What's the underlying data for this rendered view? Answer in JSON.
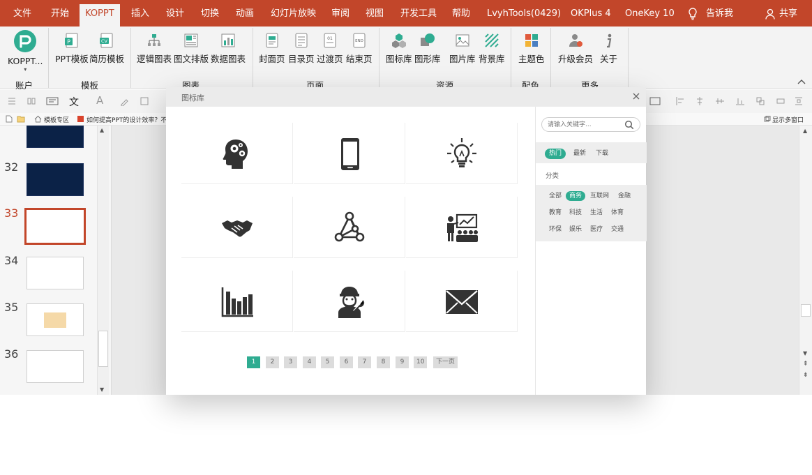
{
  "menu": {
    "items": [
      "文件",
      "开始",
      "KOPPT",
      "插入",
      "设计",
      "切换",
      "动画",
      "幻灯片放映",
      "审阅",
      "视图",
      "开发工具",
      "帮助",
      "LvyhTools(0429)",
      "OKPlus 4",
      "OneKey 10"
    ],
    "tell_me": "告诉我",
    "share": "共享"
  },
  "ribbon": {
    "account": {
      "button": "KOPPT...",
      "group": "账户"
    },
    "template": {
      "buttons": [
        "PPT模板",
        "简历模板"
      ],
      "group": "模板"
    },
    "chart": {
      "buttons": [
        "逻辑图表",
        "图文排版",
        "数据图表"
      ],
      "group": "图表"
    },
    "page": {
      "buttons": [
        "封面页",
        "目录页",
        "过渡页",
        "结束页"
      ],
      "group": "页面"
    },
    "resource": {
      "buttons": [
        "图标库",
        "图形库",
        "图片库",
        "背景库"
      ],
      "group": "资源"
    },
    "color": {
      "buttons": [
        "主题色"
      ],
      "group": "配色"
    },
    "more": {
      "buttons": [
        "升级会员",
        "关于"
      ],
      "group": "更多"
    }
  },
  "tabs_row": {
    "template_zone": "模板专区",
    "doc_tab": "如何提高PPT的设计效率？不妨",
    "multi_window": "显示多窗口"
  },
  "slides": {
    "numbers": [
      "32",
      "33",
      "34",
      "35",
      "36"
    ],
    "current": "33"
  },
  "dialog": {
    "title": "图标库",
    "icons": [
      "head-gears-icon",
      "smartphone-icon",
      "lightbulb-icon",
      "handshake-icon",
      "network-triangle-icon",
      "presentation-audience-icon",
      "bar-chart-icon",
      "worker-wrench-icon",
      "envelope-icon"
    ],
    "pagination": {
      "pages": [
        "1",
        "2",
        "3",
        "4",
        "5",
        "6",
        "7",
        "8",
        "9",
        "10"
      ],
      "current": "1",
      "next": "下一页"
    },
    "search_placeholder": "请输入关键字...",
    "filters": [
      "热门",
      "最新",
      "下载"
    ],
    "active_filter": "热门",
    "category_label": "分类",
    "categories": [
      "全部",
      "商务",
      "互联网",
      "金融",
      "教育",
      "科技",
      "生活",
      "体育",
      "环保",
      "娱乐",
      "医疗",
      "交通"
    ],
    "active_category": "商务"
  },
  "colors": {
    "accent": "#c2462a",
    "teal": "#2fac91",
    "ribbon_bg": "#f3f3f3"
  }
}
